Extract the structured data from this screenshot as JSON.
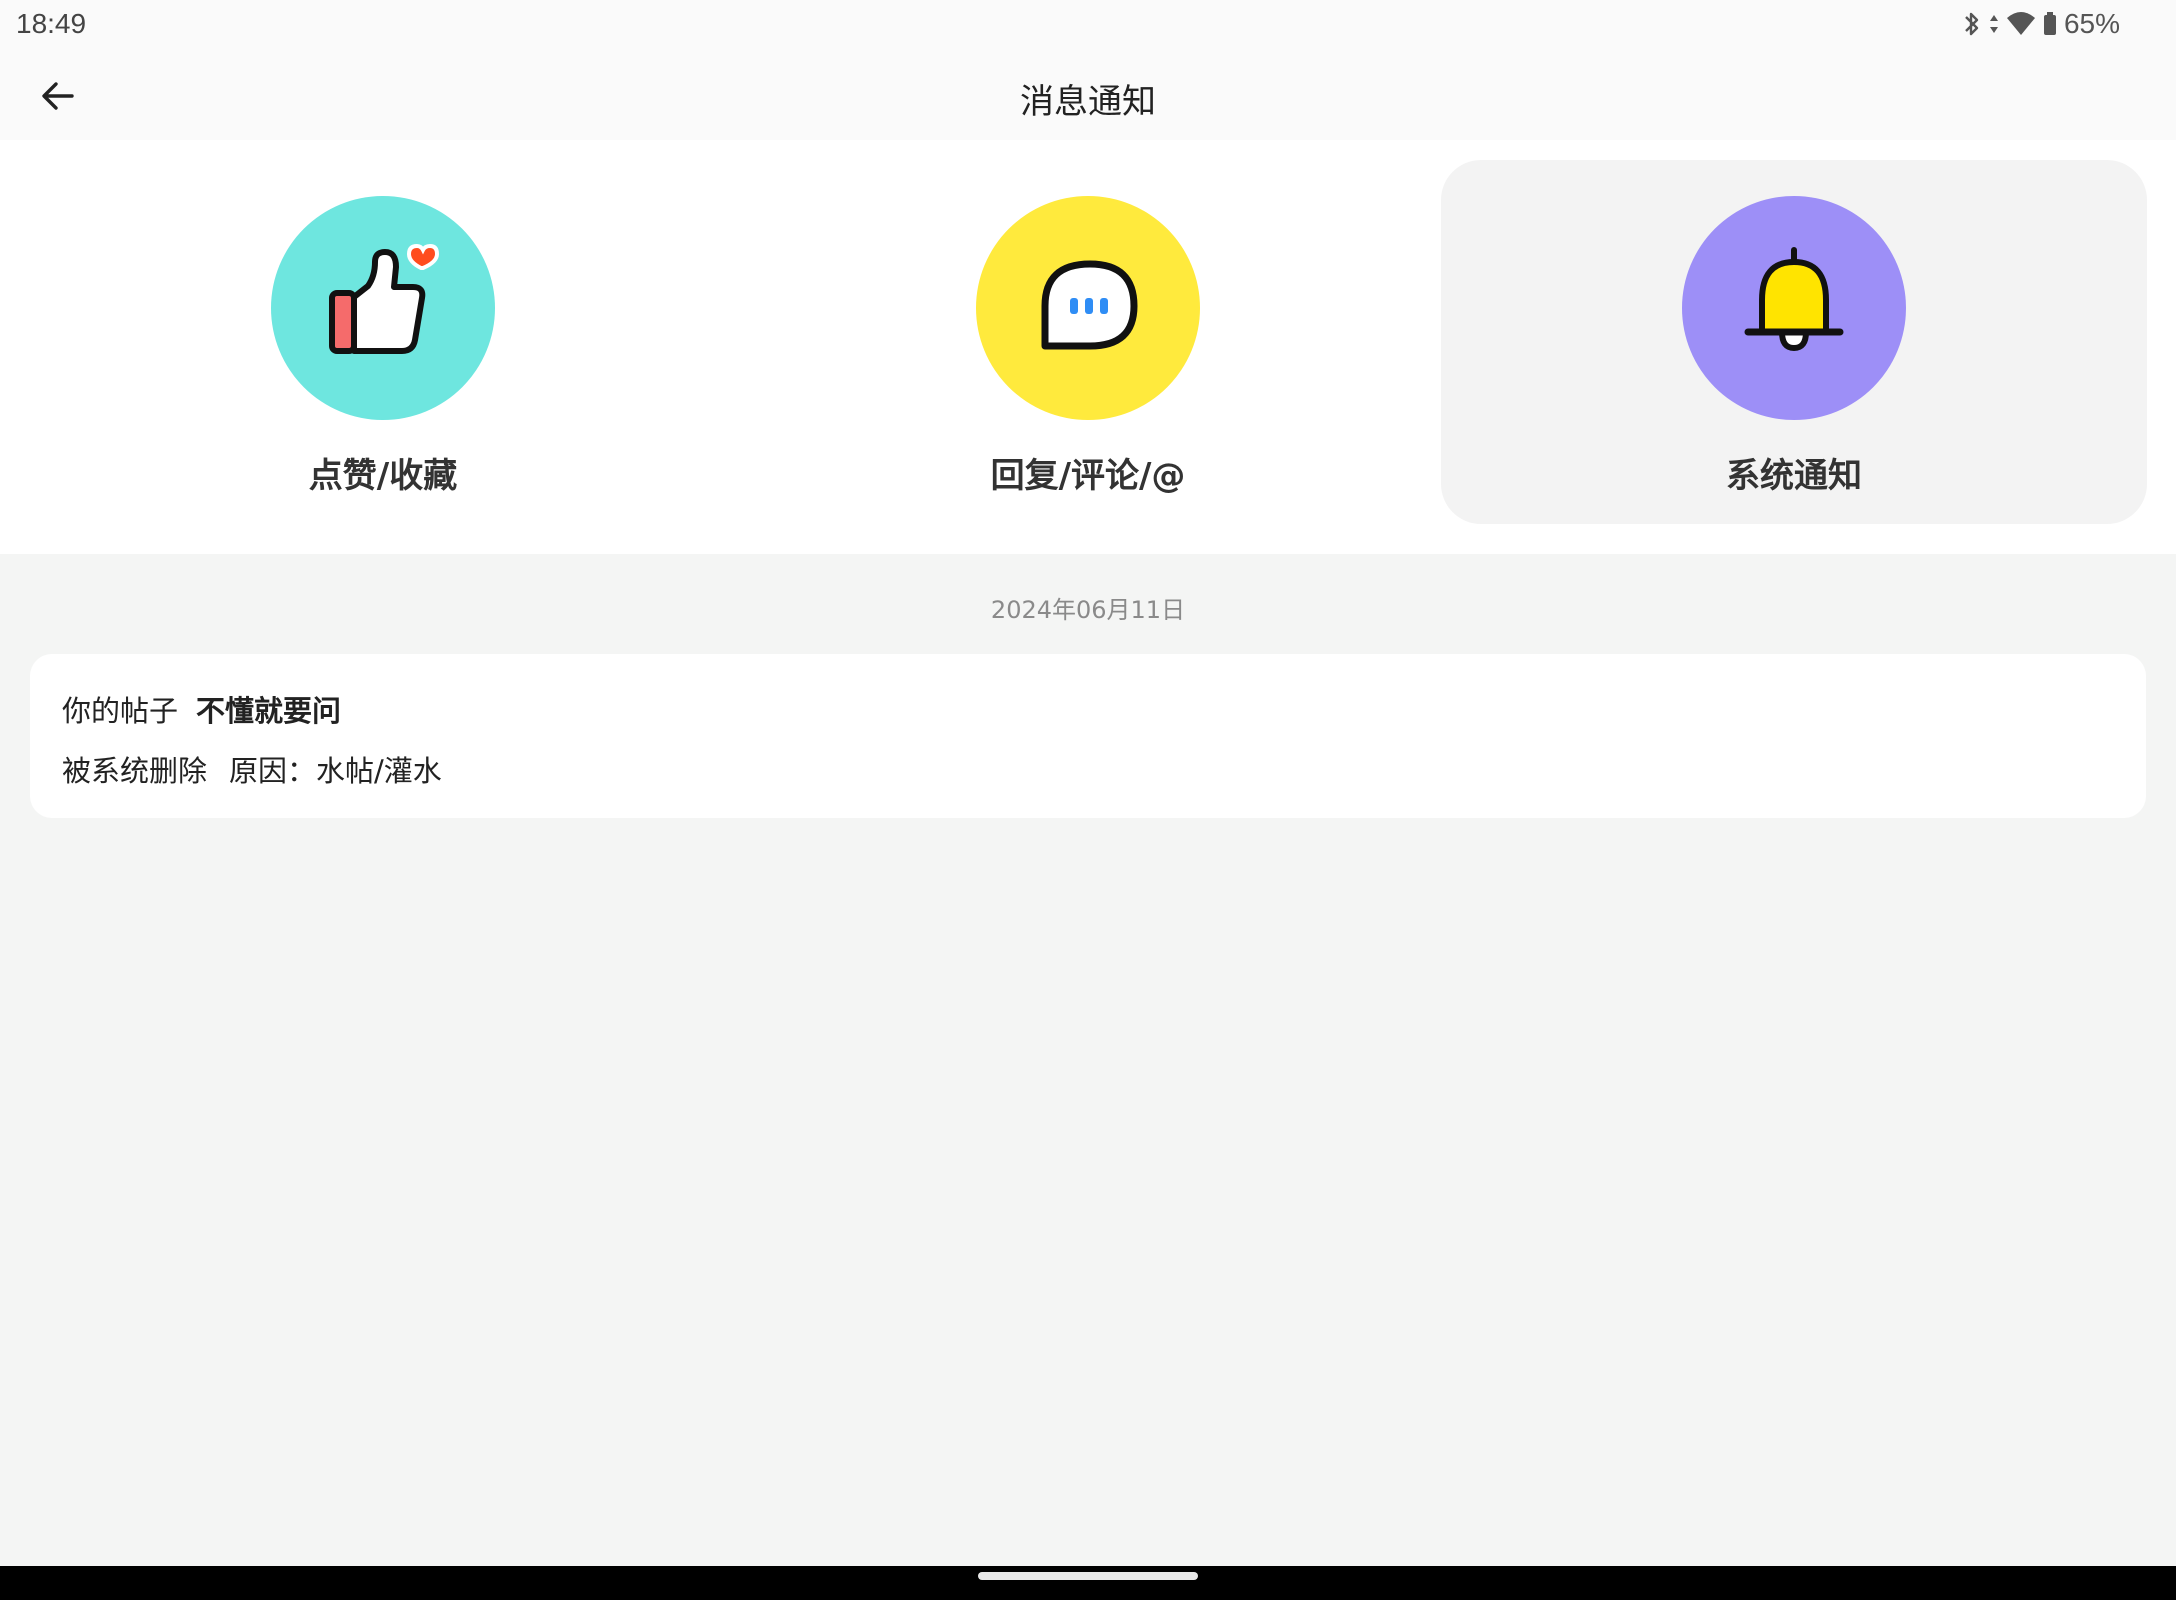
{
  "status_bar": {
    "time": "18:49",
    "battery": "65%",
    "icons": [
      "bluetooth-icon",
      "data-arrows-icon",
      "wifi-icon",
      "battery-icon"
    ]
  },
  "header": {
    "title": "消息通知",
    "back_icon": "arrow-left-icon"
  },
  "categories": [
    {
      "label": "点赞/收藏",
      "icon": "thumbs-up-heart-icon",
      "color": "#6ee6df",
      "selected": false
    },
    {
      "label": "回复/评论/@",
      "icon": "chat-bubble-icon",
      "color": "#ffea3d",
      "selected": false
    },
    {
      "label": "系统通知",
      "icon": "bell-icon",
      "color": "#9d8ff7",
      "selected": true
    }
  ],
  "notifications": [
    {
      "date": "2024年06月11日",
      "prefix": "你的帖子",
      "post_title": "不懂就要问",
      "action": "被系统删除",
      "reason": "原因：水帖/灌水"
    }
  ],
  "colors": {
    "page_bg": "#f4f5f4",
    "card_bg": "#ffffff",
    "selected_bg": "#f3f3f3"
  }
}
